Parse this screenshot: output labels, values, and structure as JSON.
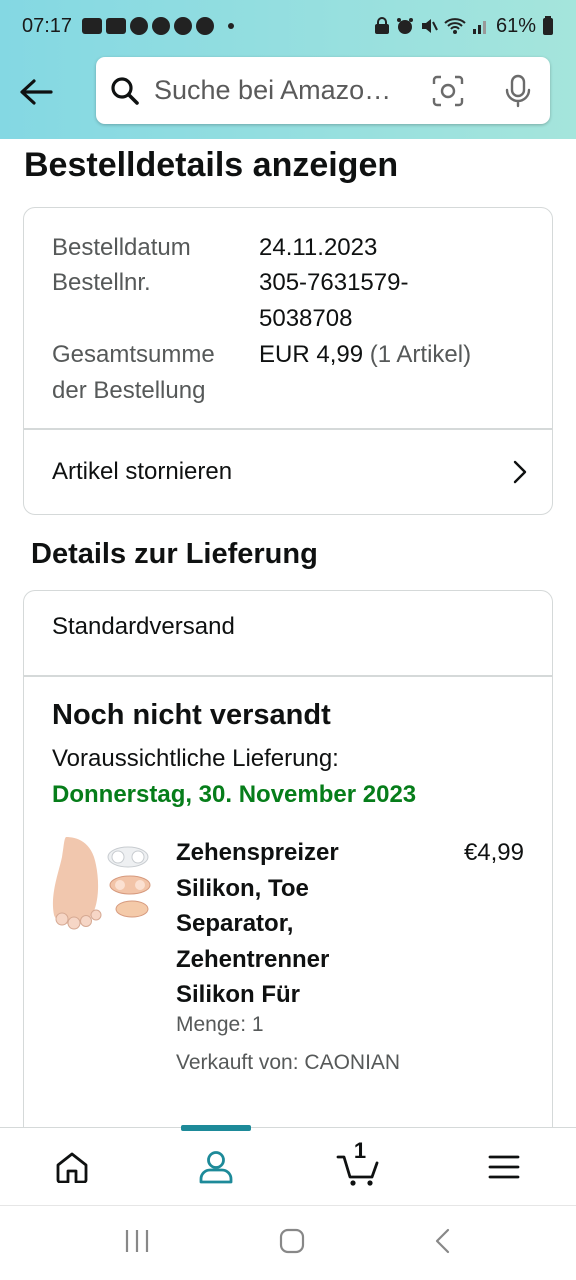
{
  "status_bar": {
    "time": "07:17",
    "battery": "61%"
  },
  "search": {
    "placeholder": "Suche bei Amazo…"
  },
  "page": {
    "title": "Bestelldetails anzeigen"
  },
  "order_summary": {
    "date_label": "Bestelldatum",
    "date_value": "24.11.2023",
    "order_no_label": "Bestellnr.",
    "order_no_line1": "305-7631579-",
    "order_no_line2": "5038708",
    "total_label_line1": "Gesamtsumme",
    "total_label_line2": "der Bestellung",
    "total_value": "EUR 4,99",
    "total_items": "(1 Artikel)",
    "cancel_label": "Artikel stornieren"
  },
  "delivery": {
    "section_title": "Details zur Lieferung",
    "shipping_method": "Standardversand",
    "status": "Noch nicht versandt",
    "expected_label": "Voraussichtliche Lieferung:",
    "expected_date": "Donnerstag, 30. November 2023",
    "date_color": "#067d1a"
  },
  "product": {
    "name_lines": [
      "Zehenspreizer",
      "Silikon, Toe",
      "Separator,",
      "Zehentrenner",
      "Silikon Für"
    ],
    "price": "€4,99",
    "quantity": "Menge: 1",
    "seller": "Verkauft von: CAONIAN"
  },
  "bottom_nav": {
    "items": [
      "home-icon",
      "account-icon",
      "cart-icon",
      "menu-icon"
    ],
    "active": "account-icon",
    "cart_count": "1",
    "accent_color": "#1d8a99"
  }
}
